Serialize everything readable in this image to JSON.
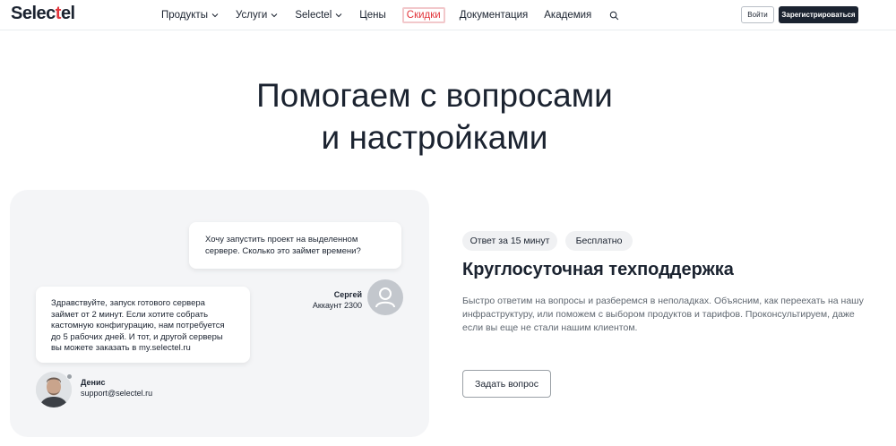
{
  "header": {
    "logo": {
      "part1": "Selec",
      "part2": "t",
      "part3": "el"
    },
    "nav": [
      {
        "label": "Продукты"
      },
      {
        "label": "Услуги"
      },
      {
        "label": "Selectel"
      },
      {
        "label": "Цены"
      },
      {
        "label": "Скидки"
      },
      {
        "label": "Документация"
      },
      {
        "label": "Академия"
      }
    ],
    "login_label": "Войти",
    "register_label": "Зарегистрироваться"
  },
  "hero": {
    "title_line1": "Помогаем с вопросами",
    "title_line2": "и настройками"
  },
  "chat": {
    "question": "Хочу запустить проект на выделенном сервере. Сколько это займет времени?",
    "customer_name": "Сергей",
    "customer_account": "Аккаунт 2300",
    "answer": "Здравствуйте, запуск готового сервера займет от 2 минут. Если хотите собрать кастомную конфигурацию, нам потребуется до 5 рабочих дней. И тот, и другой серверы вы можете заказать в my.selectel.ru",
    "agent_name": "Денис",
    "agent_email": "support@selectel.ru"
  },
  "support": {
    "chips": [
      "Ответ за 15 минут",
      "Бесплатно"
    ],
    "title": "Круглосуточная техподдержка",
    "text": "Быстро ответим на вопросы и разберемся в неполадках. Объясним, как переехать на нашу инфраструктуру, или поможем с выбором продуктов и тарифов. Проконсультируем, даже если вы еще не стали нашим клиентом.",
    "button_label": "Задать вопрос"
  },
  "colors": {
    "brand_red": "#e2363c",
    "dark": "#1b2330"
  },
  "icons": [
    "chevron-down-icon",
    "search-icon",
    "user-icon"
  ]
}
